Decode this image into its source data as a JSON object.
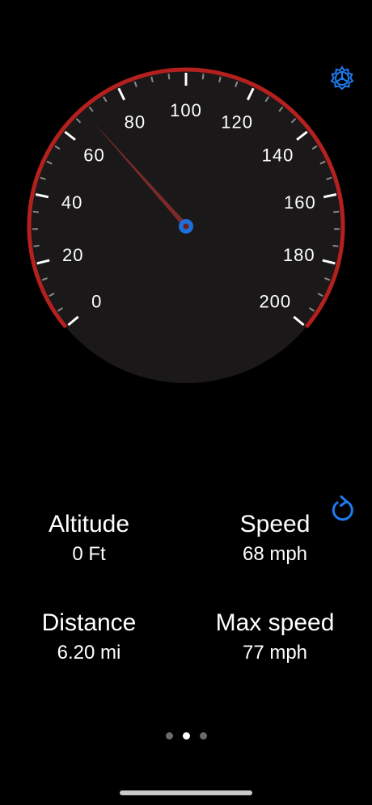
{
  "speedometer": {
    "scale_labels": [
      "0",
      "20",
      "40",
      "60",
      "80",
      "100",
      "120",
      "140",
      "160",
      "180",
      "200"
    ],
    "min": 0,
    "max": 200,
    "current_speed": 68,
    "colors": {
      "rim": "#b3201e",
      "face": "#1a1818",
      "needle": "#7a2a2a",
      "hub": "#1e6fd9",
      "accent": "#1e7bf0"
    }
  },
  "icons": {
    "settings": "gear-icon",
    "refresh": "refresh-icon"
  },
  "stats": {
    "altitude": {
      "label": "Altitude",
      "value": "0 Ft"
    },
    "speed": {
      "label": "Speed",
      "value": "68 mph"
    },
    "distance": {
      "label": "Distance",
      "value": "6.20 mi"
    },
    "max_speed": {
      "label": "Max speed",
      "value": "77 mph"
    }
  },
  "pager": {
    "pages": 3,
    "active": 1
  }
}
